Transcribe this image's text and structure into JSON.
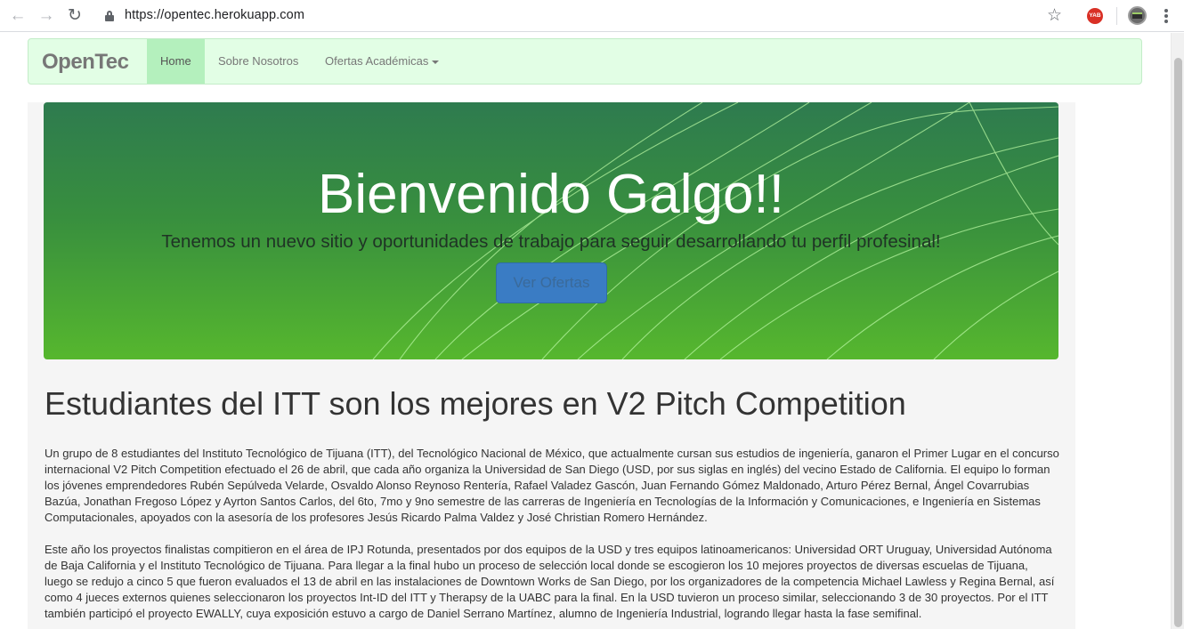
{
  "browser": {
    "url": "https://opentec.herokuapp.com",
    "extension_badge": "YAB"
  },
  "navbar": {
    "brand": "OpenTec",
    "items": [
      {
        "label": "Home",
        "active": true
      },
      {
        "label": "Sobre Nosotros",
        "active": false
      },
      {
        "label": "Ofertas Académicas",
        "active": false,
        "dropdown": true
      }
    ]
  },
  "hero": {
    "title": "Bienvenido Galgo!!",
    "subtitle": "Tenemos un nuevo sitio y oportunidades de trabajo para seguir desarrollando tu perfil profesinal!",
    "button_label": "Ver Ofertas"
  },
  "article": {
    "title": "Estudiantes del ITT son los mejores en V2 Pitch Competition",
    "paragraphs": [
      "Un grupo de 8 estudiantes del Instituto Tecnológico de Tijuana (ITT), del Tecnológico Nacional de México, que actualmente cursan sus estudios de ingeniería, ganaron el Primer Lugar en el concurso internacional V2 Pitch Competition efectuado el 26 de abril, que cada año organiza la Universidad de San Diego (USD, por sus siglas en inglés) del vecino Estado de California. El equipo lo forman los jóvenes emprendedores Rubén Sepúlveda Velarde, Osvaldo Alonso Reynoso Rentería, Rafael Valadez Gascón, Juan Fernando Gómez Maldonado, Arturo Pérez Bernal, Ángel Covarrubias Bazúa, Jonathan Fregoso López y Ayrton Santos Carlos, del 6to, 7mo y 9no semestre de las carreras de Ingeniería en Tecnologías de la Información y Comunicaciones, e Ingeniería en Sistemas Computacionales, apoyados con la asesoría de los profesores Jesús Ricardo Palma Valdez y José Christian Romero Hernández.",
      "Este año los proyectos finalistas compitieron en el área de IPJ Rotunda, presentados por dos equipos de la USD y tres equipos latinoamericanos: Universidad ORT Uruguay, Universidad Autónoma de Baja California y el Instituto Tecnológico de Tijuana. Para llegar a la final hubo un proceso de selección local donde se escogieron los 10 mejores proyectos de diversas escuelas de Tijuana, luego se redujo a cinco 5 que fueron evaluados el 13 de abril en las instalaciones de Downtown Works de San Diego, por los organizadores de la competencia Michael Lawless y Regina Bernal, así como 4 jueces externos quienes seleccionaron los proyectos Int-ID del ITT y Therapsy de la UABC para la final. En la USD tuvieron un proceso similar, seleccionando 3 de 30 proyectos. Por el ITT también participó el proyecto EWALLY, cuya exposición estuvo a cargo de Daniel Serrano Martínez, alumno de Ingeniería Industrial, logrando llegar hasta la fase semifinal."
    ]
  }
}
